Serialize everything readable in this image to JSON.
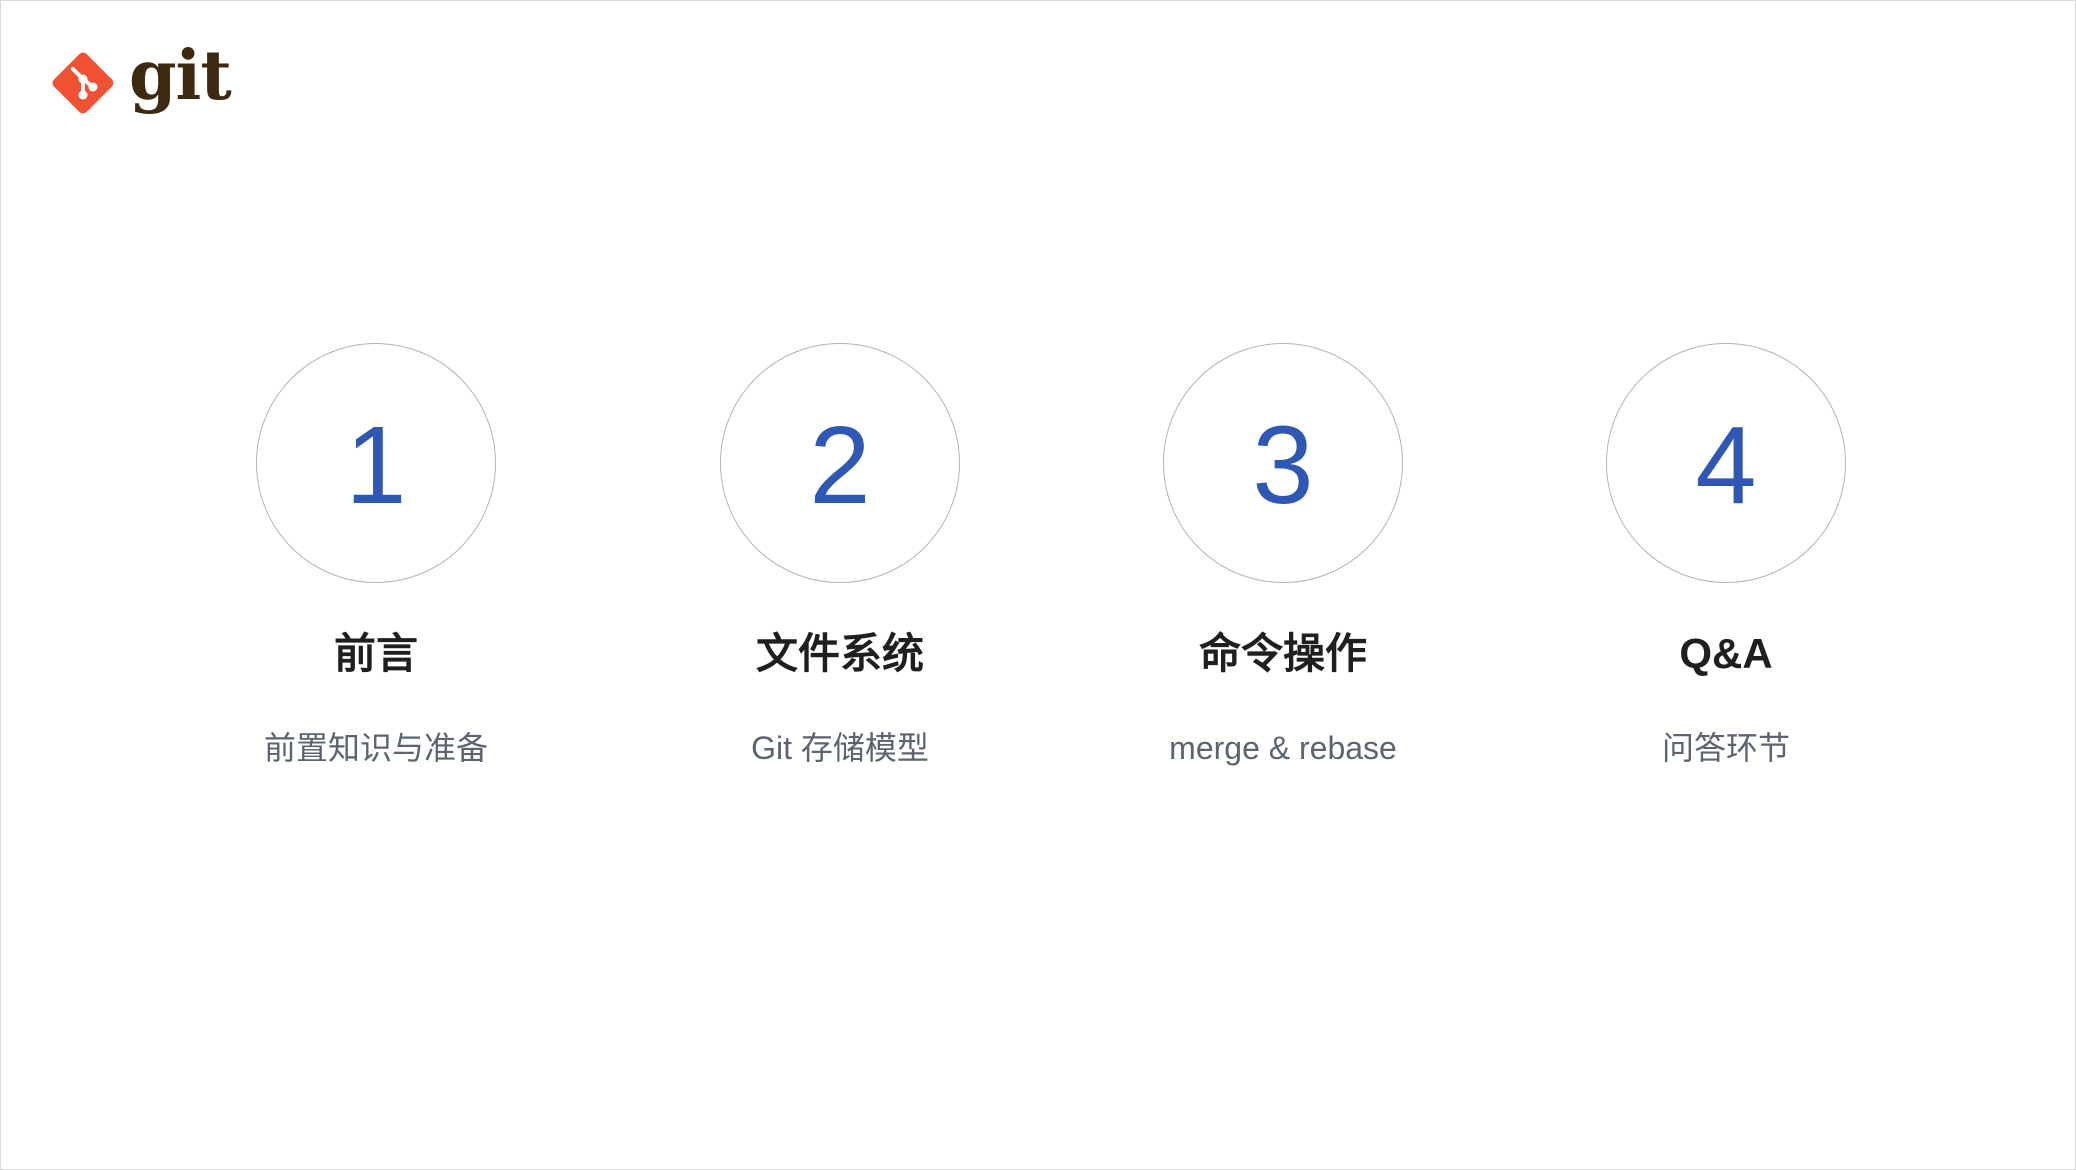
{
  "logo": {
    "icon": "git-logo-icon",
    "text": "git",
    "icon_color": "#f05133",
    "text_color": "#3b2a10"
  },
  "accent_color": "#2f57b4",
  "steps": [
    {
      "number": "1",
      "title": "前言",
      "subtitle": "前置知识与准备"
    },
    {
      "number": "2",
      "title": "文件系统",
      "subtitle": "Git 存储模型"
    },
    {
      "number": "3",
      "title": "命令操作",
      "subtitle": "merge & rebase"
    },
    {
      "number": "4",
      "title": "Q&A",
      "subtitle": "问答环节"
    }
  ]
}
